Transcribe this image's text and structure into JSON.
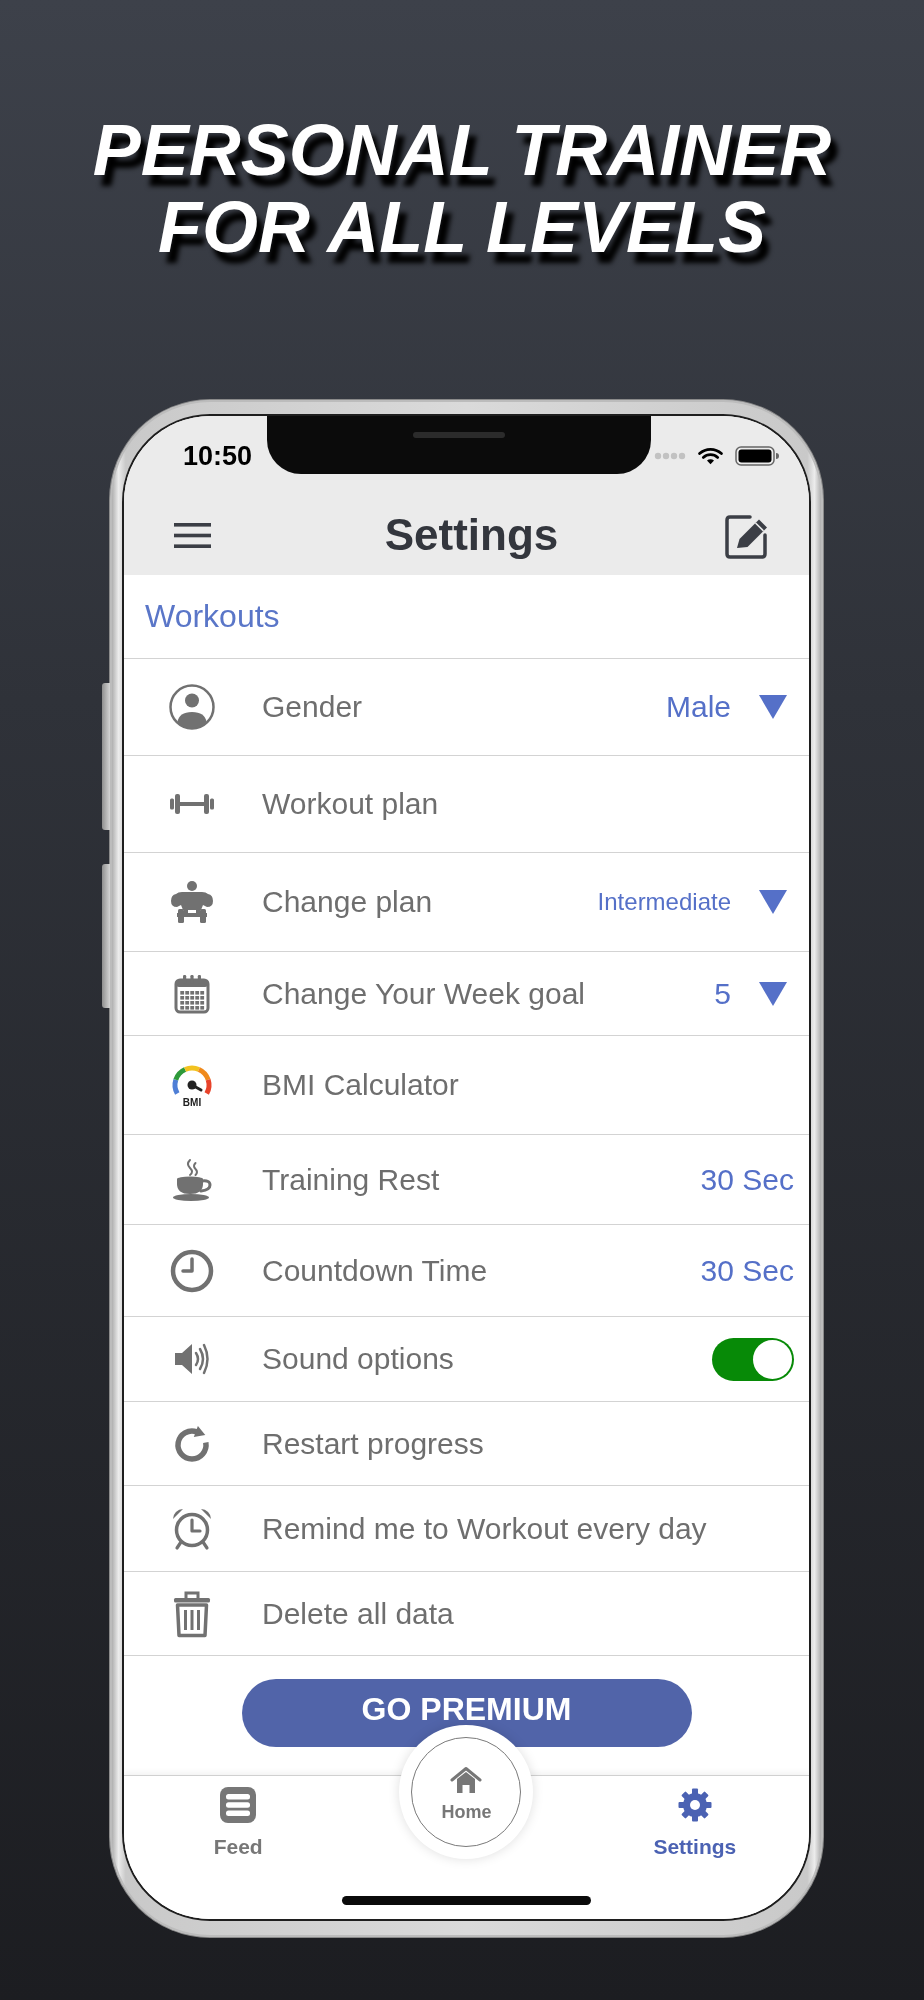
{
  "headline": "PERSONAL TRAINER FOR ALL LEVELS",
  "status_bar": {
    "time": "10:50"
  },
  "header": {
    "title": "Settings"
  },
  "section": {
    "title": "Workouts"
  },
  "rows": [
    {
      "kind": "dropdown",
      "label": "Gender",
      "value": "Male"
    },
    {
      "kind": "plain",
      "label": "Workout plan"
    },
    {
      "kind": "dropdown",
      "label": "Change plan",
      "value": "Intermediate"
    },
    {
      "kind": "dropdown",
      "label": "Change Your Week goal",
      "value": "5"
    },
    {
      "kind": "plain",
      "label": "BMI Calculator",
      "icon_text": "BMI"
    },
    {
      "kind": "value",
      "label": "Training Rest",
      "value": "30 Sec"
    },
    {
      "kind": "value",
      "label": "Countdown Time",
      "value": "30 Sec"
    },
    {
      "kind": "toggle",
      "label": "Sound options",
      "on": true
    },
    {
      "kind": "plain",
      "label": "Restart progress"
    },
    {
      "kind": "plain",
      "label": "Remind me to Workout every day"
    },
    {
      "kind": "plain",
      "label": "Delete all data"
    }
  ],
  "premium_button": {
    "label": "GO PREMIUM"
  },
  "tabs": [
    {
      "kind": "tab",
      "label": "Feed",
      "selected": false
    },
    {
      "kind": "center",
      "label": "Home",
      "selected": false
    },
    {
      "kind": "tab",
      "label": "Settings",
      "selected": true
    }
  ]
}
